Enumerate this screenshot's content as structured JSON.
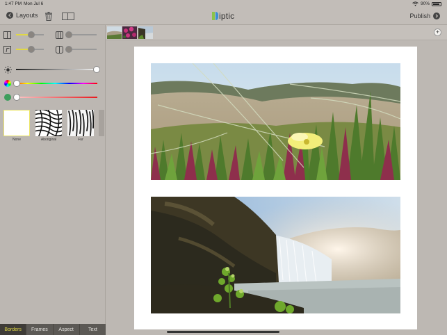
{
  "status_bar": {
    "time": "1:47 PM",
    "date": "Mon Jul 6",
    "battery": "90%",
    "battery_fraction": 0.9
  },
  "toolbar": {
    "back_label": "Layouts",
    "app_name_rest": "iptic",
    "publish_label": "Publish"
  },
  "controls": {
    "border_width_fraction": 0.55,
    "corner_radius_fraction": 0.0,
    "outer_border_fraction": 0.55,
    "inner_radius_fraction": 0.0,
    "brightness_fraction": 1.0,
    "hue_fraction": 0.0,
    "saturation_fraction": 0.0
  },
  "textures": [
    {
      "label": "None"
    },
    {
      "label": "Aboriginal"
    },
    {
      "label": "Fur"
    }
  ],
  "tabs": [
    {
      "label": "Borders"
    },
    {
      "label": "Frames"
    },
    {
      "label": "Aspect"
    },
    {
      "label": "Text"
    }
  ],
  "colors": {
    "accent": "#e0d845",
    "highlight_border": "#ece56a"
  }
}
